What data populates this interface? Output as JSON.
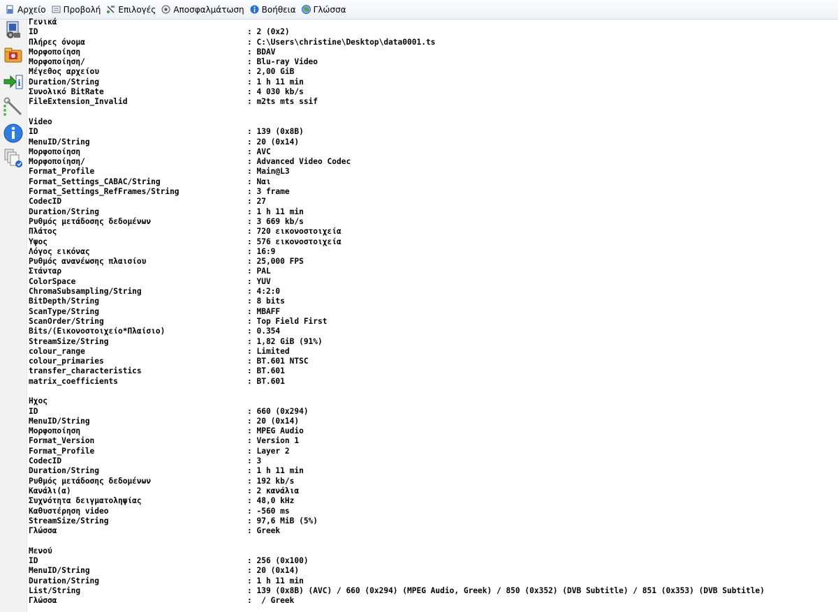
{
  "menu": [
    {
      "name": "menu-file",
      "label": "Αρχείο",
      "icon": "file-icon"
    },
    {
      "name": "menu-view",
      "label": "Προβολή",
      "icon": "view-icon"
    },
    {
      "name": "menu-options",
      "label": "Επιλογές",
      "icon": "options-icon"
    },
    {
      "name": "menu-debug",
      "label": "Αποσφαλμάτωση",
      "icon": "debug-icon"
    },
    {
      "name": "menu-help",
      "label": "Βοήθεια",
      "icon": "help-icon"
    },
    {
      "name": "menu-language",
      "label": "Γλώσσα",
      "icon": "globe-icon"
    }
  ],
  "toolbar": [
    {
      "name": "open-file-button",
      "icon": "open-file-icon"
    },
    {
      "name": "open-folder-button",
      "icon": "open-folder-icon"
    },
    {
      "name": "export-button",
      "icon": "export-icon"
    },
    {
      "name": "preferences-button",
      "icon": "preferences-icon"
    },
    {
      "name": "about-button",
      "icon": "info-icon"
    },
    {
      "name": "knowledge-base-button",
      "icon": "knowledge-base-icon"
    }
  ],
  "sections": [
    {
      "title": "Γενικά",
      "rows": [
        {
          "key": "ID",
          "value": ": 2 (0x2)"
        },
        {
          "key": "Πλήρες όνομα",
          "value": ": C:\\Users\\christine\\Desktop\\data0001.ts"
        },
        {
          "key": "Μορφοποίηση",
          "value": ": BDAV"
        },
        {
          "key": "Μορφοποίηση/",
          "value": ": Blu-ray Video"
        },
        {
          "key": "Μέγεθος αρχείου",
          "value": ": 2,00 GiB"
        },
        {
          "key": "Duration/String",
          "value": ": 1 h 11 min"
        },
        {
          "key": "Συνολικό BitRate",
          "value": ": 4 030 kb/s"
        },
        {
          "key": "FileExtension_Invalid",
          "value": ": m2ts mts ssif"
        }
      ]
    },
    {
      "title": "Video",
      "rows": [
        {
          "key": "ID",
          "value": ": 139 (0x8B)"
        },
        {
          "key": "MenuID/String",
          "value": ": 20 (0x14)"
        },
        {
          "key": "Μορφοποίηση",
          "value": ": AVC"
        },
        {
          "key": "Μορφοποίηση/",
          "value": ": Advanced Video Codec"
        },
        {
          "key": "Format_Profile",
          "value": ": Main@L3"
        },
        {
          "key": "Format_Settings_CABAC/String",
          "value": ": Ναι"
        },
        {
          "key": "Format_Settings_RefFrames/String",
          "value": ": 3 frame"
        },
        {
          "key": "CodecID",
          "value": ": 27"
        },
        {
          "key": "Duration/String",
          "value": ": 1 h 11 min"
        },
        {
          "key": "Ρυθμός μετάδοσης δεδομένων",
          "value": ": 3 669 kb/s"
        },
        {
          "key": "Πλάτος",
          "value": ": 720 εικονοστοιχεία"
        },
        {
          "key": "Ύψος",
          "value": ": 576 εικονοστοιχεία"
        },
        {
          "key": "Λόγος εικόνας",
          "value": ": 16:9"
        },
        {
          "key": "Ρυθμός ανανέωσης πλαισίου",
          "value": ": 25,000 FPS"
        },
        {
          "key": "Στάνταρ",
          "value": ": PAL"
        },
        {
          "key": "ColorSpace",
          "value": ": YUV"
        },
        {
          "key": "ChromaSubsampling/String",
          "value": ": 4:2:0"
        },
        {
          "key": "BitDepth/String",
          "value": ": 8 bits"
        },
        {
          "key": "ScanType/String",
          "value": ": MBAFF"
        },
        {
          "key": "ScanOrder/String",
          "value": ": Top Field First"
        },
        {
          "key": "Bits/(Εικονοστοιχείο*Πλαίσιο)",
          "value": ": 0.354"
        },
        {
          "key": "StreamSize/String",
          "value": ": 1,82 GiB (91%)"
        },
        {
          "key": "colour_range",
          "value": ": Limited"
        },
        {
          "key": "colour_primaries",
          "value": ": BT.601 NTSC"
        },
        {
          "key": "transfer_characteristics",
          "value": ": BT.601"
        },
        {
          "key": "matrix_coefficients",
          "value": ": BT.601"
        }
      ]
    },
    {
      "title": "Ηχος",
      "rows": [
        {
          "key": "ID",
          "value": ": 660 (0x294)"
        },
        {
          "key": "MenuID/String",
          "value": ": 20 (0x14)"
        },
        {
          "key": "Μορφοποίηση",
          "value": ": MPEG Audio"
        },
        {
          "key": "Format_Version",
          "value": ": Version 1"
        },
        {
          "key": "Format_Profile",
          "value": ": Layer 2"
        },
        {
          "key": "CodecID",
          "value": ": 3"
        },
        {
          "key": "Duration/String",
          "value": ": 1 h 11 min"
        },
        {
          "key": "Ρυθμός μετάδοσης δεδομένων",
          "value": ": 192 kb/s"
        },
        {
          "key": "Κανάλι(α)",
          "value": ": 2 κανάλια"
        },
        {
          "key": "Συχνότητα δειγματοληψίας",
          "value": ": 48,0 kHz"
        },
        {
          "key": "Καθυστέρηση video",
          "value": ": -560 ms"
        },
        {
          "key": "StreamSize/String",
          "value": ": 97,6 MiB (5%)"
        },
        {
          "key": "Γλώσσα",
          "value": ": Greek"
        }
      ]
    },
    {
      "title": "Μενού",
      "rows": [
        {
          "key": "ID",
          "value": ": 256 (0x100)"
        },
        {
          "key": "MenuID/String",
          "value": ": 20 (0x14)"
        },
        {
          "key": "Duration/String",
          "value": ": 1 h 11 min"
        },
        {
          "key": "List/String",
          "value": ": 139 (0x8B) (AVC) / 660 (0x294) (MPEG Audio, Greek) / 850 (0x352) (DVB Subtitle) / 851 (0x353) (DVB Subtitle)"
        },
        {
          "key": "Γλώσσα",
          "value": ":  / Greek"
        }
      ]
    }
  ]
}
